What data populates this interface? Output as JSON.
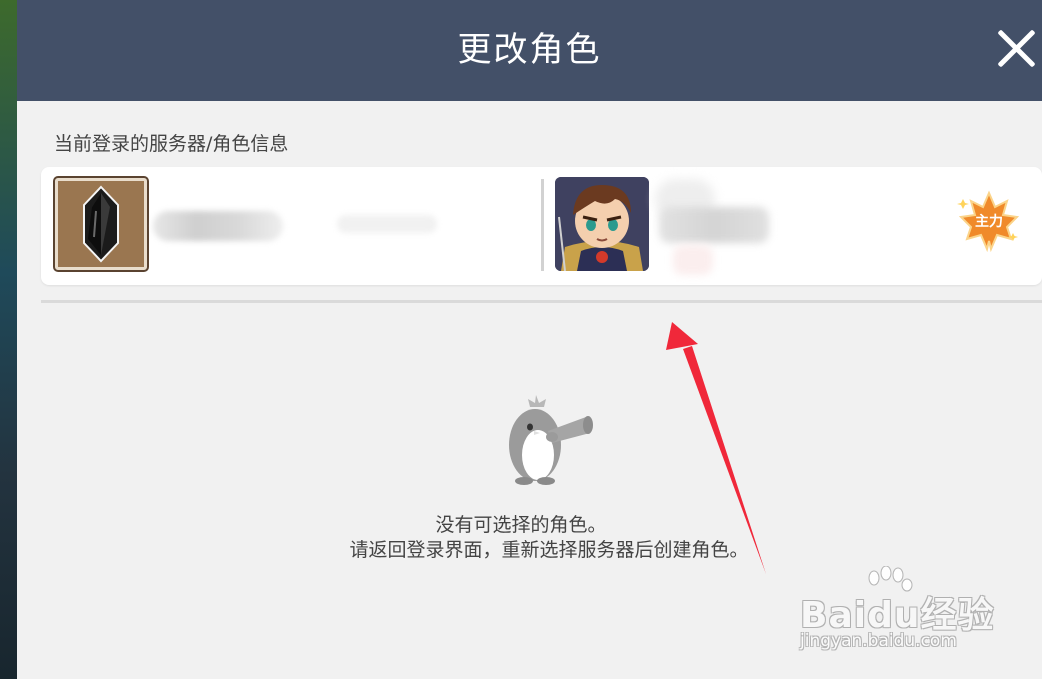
{
  "dialog": {
    "title": "更改角色",
    "close_icon": "close-icon"
  },
  "current_info": {
    "section_label": "当前登录的服务器/角色信息",
    "server_icon": "black-crystal-icon",
    "character_avatar": "hero-avatar",
    "main_badge": {
      "label": "主力",
      "icon": "maple-leaf-badge-icon",
      "color": "#f08a2a"
    }
  },
  "empty_state": {
    "icon": "penguin-telescope-icon",
    "line1": "没有可选择的角色。",
    "line2": "请返回登录界面，重新选择服务器后创建角色。"
  },
  "watermark": {
    "brand": "Baidu经验",
    "url": "jingyan.baidu.com"
  },
  "colors": {
    "header": "#435068",
    "body": "#f1f1f1",
    "annotation_arrow": "#f0283a"
  }
}
